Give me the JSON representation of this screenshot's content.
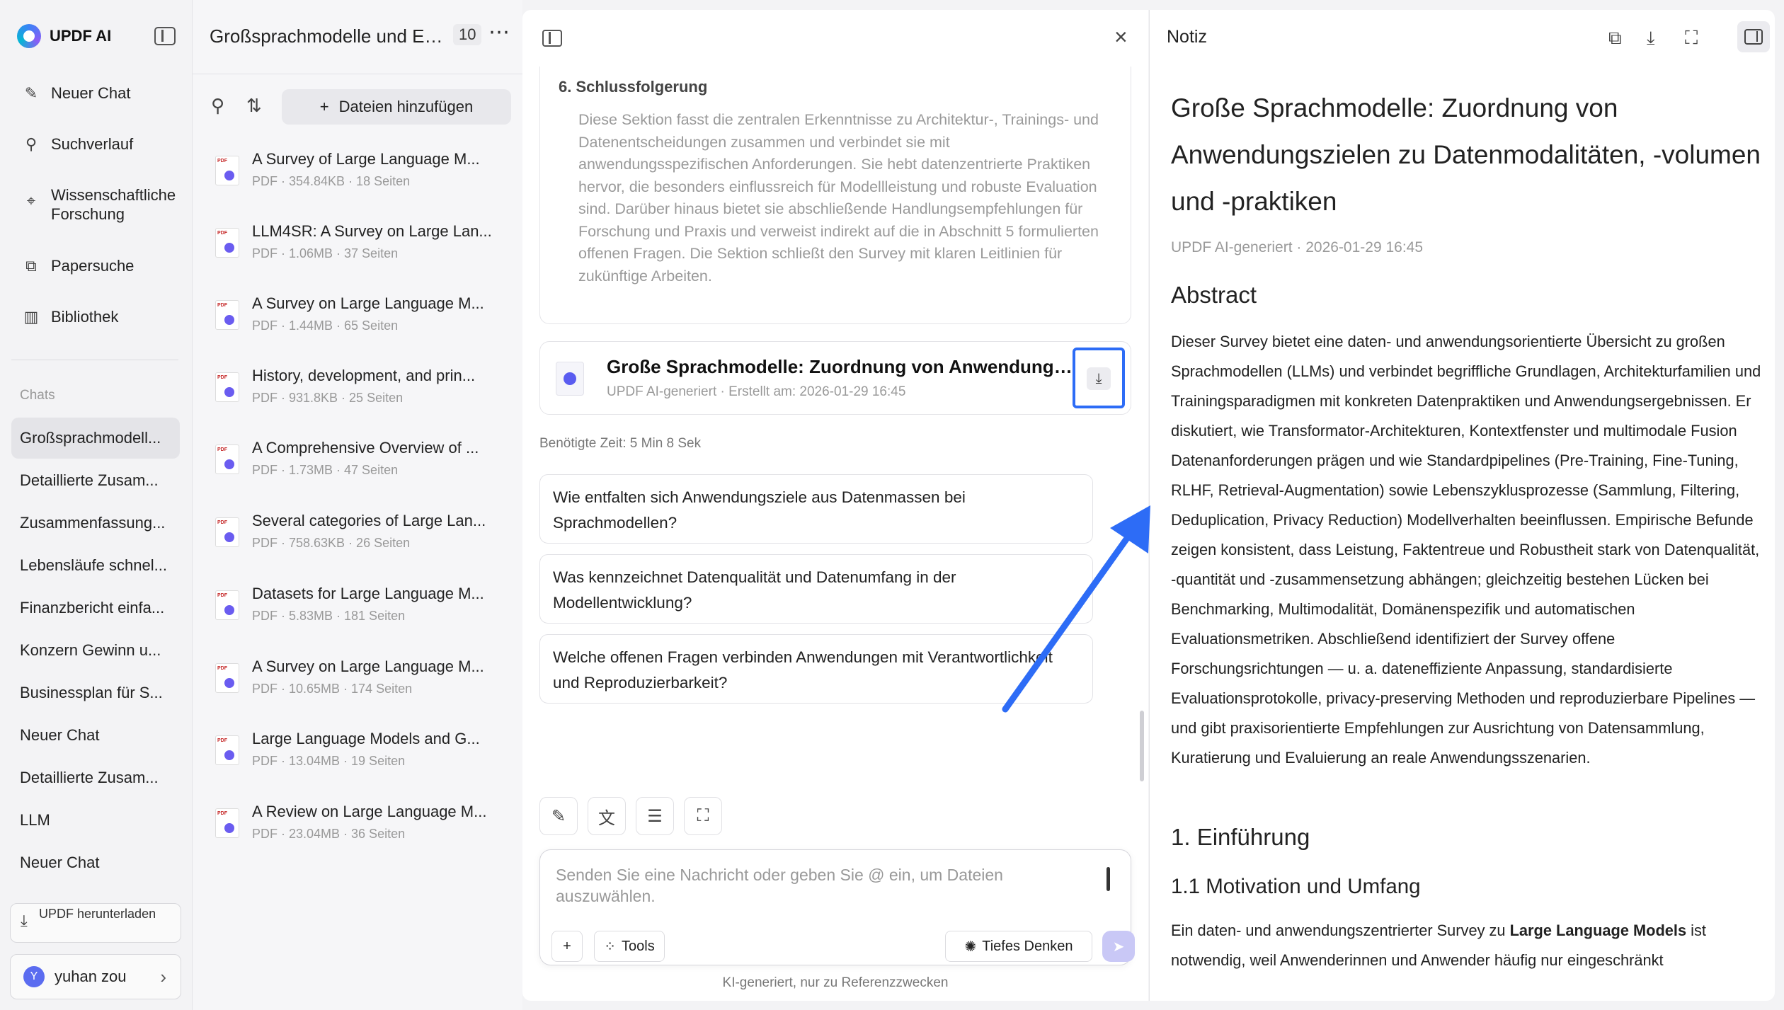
{
  "nav": {
    "brand": "UPDF AI",
    "items": [
      {
        "label": "Neuer Chat",
        "icon": "edit-icon"
      },
      {
        "label": "Suchverlauf",
        "icon": "search-icon"
      },
      {
        "label": "Wissenschaftliche Forschung",
        "icon": "telescope-icon"
      },
      {
        "label": "Papersuche",
        "icon": "paper-search-icon"
      },
      {
        "label": "Bibliothek",
        "icon": "library-icon"
      }
    ],
    "chats_label": "Chats",
    "chats": [
      "Großsprachmodell...",
      "Detaillierte Zusam...",
      "Zusammenfassung...",
      "Lebensläufe schnel...",
      "Finanzbericht einfa...",
      "Konzern Gewinn u...",
      "Businessplan für S...",
      "Neuer Chat",
      "Detaillierte Zusam...",
      "LLM",
      "Neuer Chat"
    ],
    "download_app": "UPDF herunterladen",
    "user": {
      "initial": "Y",
      "name": "yuhan zou"
    }
  },
  "files": {
    "header": "Großsprachmodelle und Ei...",
    "count": "10",
    "add_label": "Dateien hinzufügen",
    "items": [
      {
        "title": "A Survey of Large Language M...",
        "meta": "PDF · 354.84KB · 18 Seiten"
      },
      {
        "title": "LLM4SR: A Survey on Large Lan...",
        "meta": "PDF · 1.06MB · 37 Seiten"
      },
      {
        "title": "A Survey on Large Language M...",
        "meta": "PDF · 1.44MB · 65 Seiten"
      },
      {
        "title": "History, development, and prin...",
        "meta": "PDF · 931.8KB · 25 Seiten"
      },
      {
        "title": "A Comprehensive Overview of ...",
        "meta": "PDF · 1.73MB · 47 Seiten"
      },
      {
        "title": "Several categories of Large Lan...",
        "meta": "PDF · 758.63KB · 26 Seiten"
      },
      {
        "title": "Datasets for Large Language M...",
        "meta": "PDF · 5.83MB · 181 Seiten"
      },
      {
        "title": "A Survey on Large Language M...",
        "meta": "PDF · 10.65MB · 174 Seiten"
      },
      {
        "title": "Large Language Models and G...",
        "meta": "PDF · 13.04MB · 19 Seiten"
      },
      {
        "title": "A Review on Large Language M...",
        "meta": "PDF · 23.04MB · 36 Seiten"
      }
    ]
  },
  "chat": {
    "section_title": "6. Schlussfolgerung",
    "section_body": "Diese Sektion fasst die zentralen Erkenntnisse zu Architektur-, Trainings- und Datenentscheidungen zusammen und verbindet sie mit anwendungsspezifischen Anforderungen. Sie hebt datenzentrierte Praktiken hervor, die besonders einflussreich für Modellleistung und robuste Evaluation sind. Darüber hinaus bietet sie abschließende Handlungsempfehlungen für Forschung und Praxis und verweist indirekt auf die in Abschnitt 5 formulierten offenen Fragen. Die Sektion schließt den Survey mit klaren Leitlinien für zukünftige Arbeiten.",
    "doc_title": "Große Sprachmodelle: Zuordnung von Anwendungszielen zu Datenmodalitäten, -volumen und -praktiken",
    "doc_meta": "UPDF AI-generiert · Erstellt am: 2026-01-29 16:45",
    "time_needed": "Benötigte Zeit: 5 Min 8 Sek",
    "suggestions": [
      "Wie entfalten sich Anwendungsziele aus Datenmassen bei Sprachmodellen?",
      "Was kennzeichnet Datenqualität und Datenumfang in der Modellentwicklung?",
      "Welche offenen Fragen verbinden Anwendungen mit Verantwortlichkeit und Reproduzierbarkeit?"
    ],
    "placeholder": "Senden Sie eine Nachricht oder geben Sie @ ein, um Dateien auszuwählen.",
    "tools_label": "Tools",
    "deep_think_label": "Tiefes Denken",
    "disclaimer": "KI-generiert, nur zu Referenzzwecken"
  },
  "notes": {
    "title": "Notiz",
    "h1": "Große Sprachmodelle: Zuordnung von Anwendungszielen zu Datenmodalitäten, -volumen und -praktiken",
    "meta": "UPDF AI-generiert · 2026-01-29 16:45",
    "abstract_heading": "Abstract",
    "abstract": "Dieser Survey bietet eine daten- und anwendungsorientierte Übersicht zu großen Sprachmodellen (LLMs) und verbindet begriffliche Grundlagen, Architekturfamilien und Trainingsparadigmen mit konkreten Datenpraktiken und Anwendungsergebnissen. Er diskutiert, wie Transformator-Architekturen, Kontextfenster und multimodale Fusion Datenanforderungen prägen und wie Standardpipelines (Pre-Training, Fine-Tuning, RLHF, Retrieval-Augmentation) sowie Lebenszyklusprozesse (Sammlung, Filtering, Deduplication, Privacy Reduction) Modellverhalten beeinflussen. Empirische Befunde zeigen konsistent, dass Leistung, Faktentreue und Robustheit stark von Datenqualität, -quantität und -zusammensetzung abhängen; gleichzeitig bestehen Lücken bei Benchmarking, Multimodalität, Domänenspezifik und automatischen Evaluationsmetriken. Abschließend identifiziert der Survey offene Forschungsrichtungen — u. a. dateneffiziente Anpassung, standardisierte Evaluationsprotokolle, privacy-preserving Methoden und reproduzierbare Pipelines — und gibt praxisorientierte Empfehlungen zur Ausrichtung von Datensammlung, Kuratierung und Evaluierung an reale Anwendungsszenarien.",
    "intro_heading": "1. Einführung",
    "motivation_heading": "1.1 Motivation und Umfang",
    "motivation_pre": "Ein daten- und anwendungszentrierter Survey zu ",
    "motivation_bold": "Large Language Models",
    "motivation_post": " ist notwendig, weil Anwenderinnen und Anwender häufig nur eingeschränkt"
  },
  "colors": {
    "accent_blue": "#2d6cf6",
    "send_button": "#c9c8f6",
    "active_chat_bg": "#e4e4e8"
  }
}
